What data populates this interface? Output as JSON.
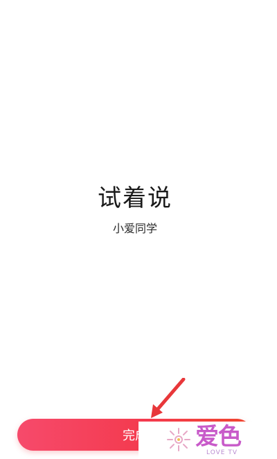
{
  "prompt": {
    "title": "试着说",
    "subtitle": "小爱同学"
  },
  "footer": {
    "done_label": "完成"
  },
  "watermark": {
    "brand": "爱色",
    "tagline": "LOVE TV"
  },
  "colors": {
    "button_start": "#f64a6b",
    "button_end": "#f0452e",
    "arrow": "#e8373a",
    "watermark": "#c85ac9"
  }
}
